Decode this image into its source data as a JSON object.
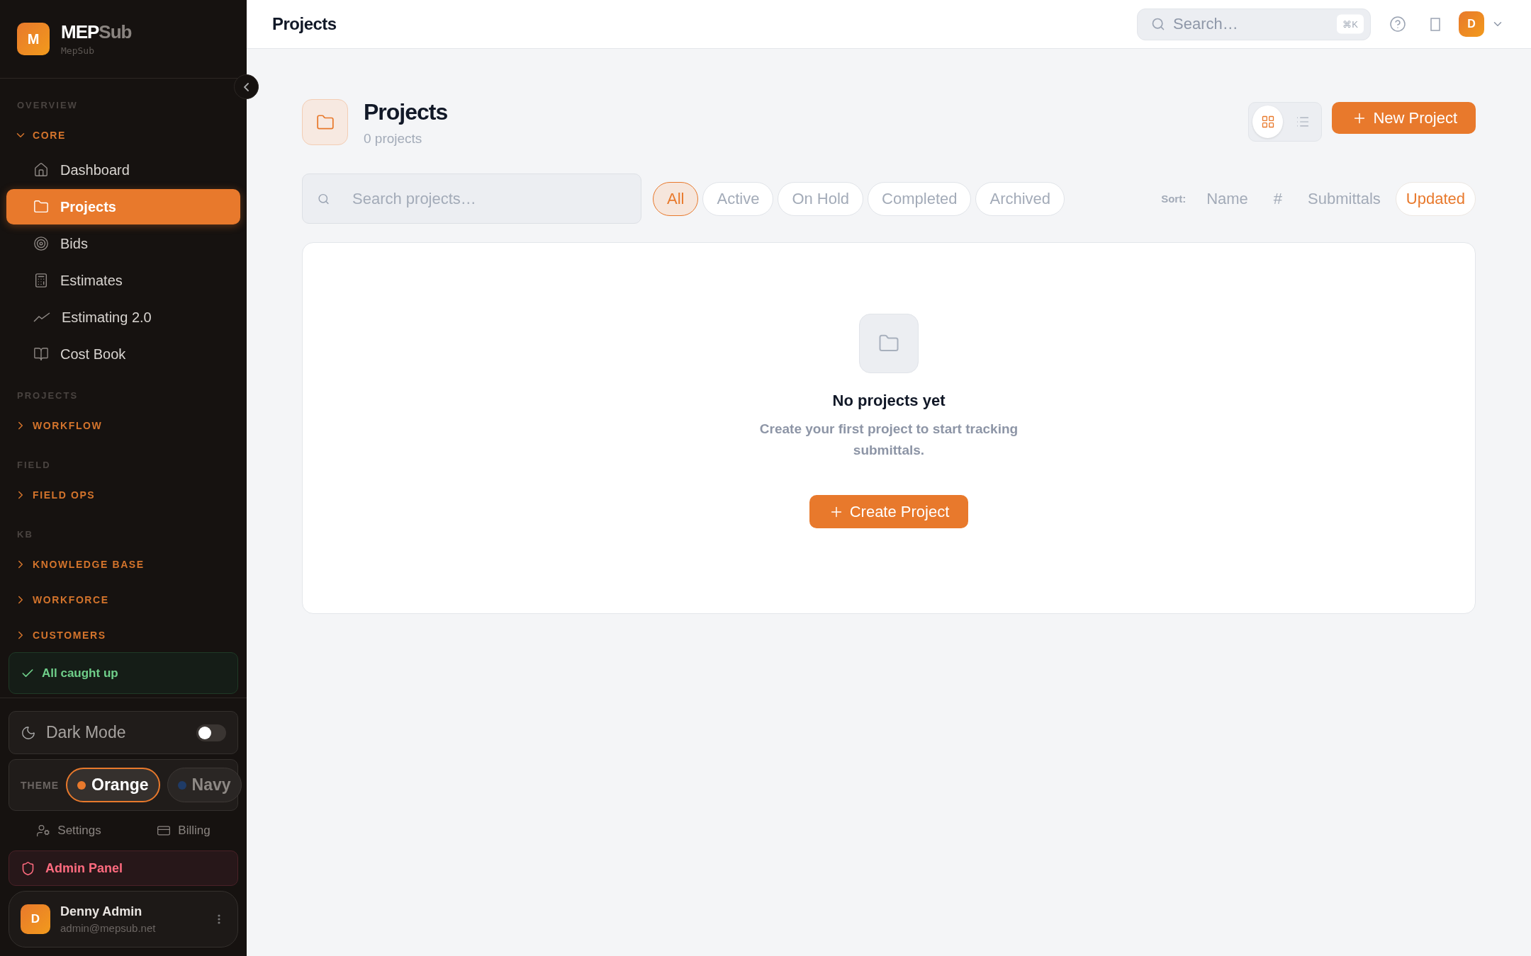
{
  "sidebar": {
    "brand": {
      "logo_letter": "M",
      "name_primary": "MEP",
      "name_secondary": "Sub",
      "subtitle": "MepSub"
    },
    "sections": [
      {
        "label": "OVERVIEW",
        "groups": [
          {
            "label": "CORE",
            "expanded": true,
            "items": [
              {
                "label": "Dashboard",
                "selected": false
              },
              {
                "label": "Projects",
                "selected": true
              },
              {
                "label": "Bids",
                "selected": false
              },
              {
                "label": "Estimates",
                "selected": false
              },
              {
                "label": "Estimating 2.0",
                "selected": false
              },
              {
                "label": "Cost Book",
                "selected": false
              }
            ]
          }
        ]
      },
      {
        "label": "PROJECTS",
        "groups": [
          {
            "label": "WORKFLOW",
            "expanded": false
          }
        ]
      },
      {
        "label": "FIELD",
        "groups": [
          {
            "label": "FIELD OPS",
            "expanded": false
          }
        ]
      },
      {
        "label": "KB",
        "groups": [
          {
            "label": "KNOWLEDGE BASE",
            "expanded": false
          },
          {
            "label": "WORKFORCE",
            "expanded": false
          },
          {
            "label": "CUSTOMERS",
            "expanded": false
          }
        ]
      }
    ],
    "status": "All caught up",
    "dark_mode": {
      "label": "Dark Mode",
      "on": false
    },
    "theme": {
      "label": "THEME",
      "options": [
        {
          "label": "Orange",
          "color": "#e8792c",
          "selected": true
        },
        {
          "label": "Navy",
          "color": "#1f3b66",
          "selected": false
        }
      ]
    },
    "links": [
      "Settings",
      "Billing"
    ],
    "admin": "Admin Panel",
    "user": {
      "initial": "D",
      "name": "Denny Admin",
      "email": "admin@mepsub.net"
    }
  },
  "header": {
    "title": "Projects",
    "search": {
      "placeholder": "Search…",
      "shortcut": "⌘K"
    },
    "avatar": "D"
  },
  "page": {
    "title": "Projects",
    "count": "0 projects",
    "view_toggle": [
      {
        "kind": "grid",
        "selected": true
      },
      {
        "kind": "list",
        "selected": false
      }
    ],
    "new_button": "New Project",
    "search": {
      "placeholder": "Search projects…"
    },
    "filters": [
      {
        "label": "All",
        "selected": true
      },
      {
        "label": "Active",
        "selected": false
      },
      {
        "label": "On Hold",
        "selected": false
      },
      {
        "label": "Completed",
        "selected": false
      },
      {
        "label": "Archived",
        "selected": false
      }
    ],
    "sort": {
      "label": "Sort:",
      "options": [
        {
          "label": "Name",
          "selected": false
        },
        {
          "label": "#",
          "selected": false
        },
        {
          "label": "Submittals",
          "selected": false
        },
        {
          "label": "Updated",
          "selected": true
        }
      ]
    },
    "empty": {
      "title": "No projects yet",
      "message": "Create your first project to start tracking submittals.",
      "button": "Create Project"
    }
  }
}
